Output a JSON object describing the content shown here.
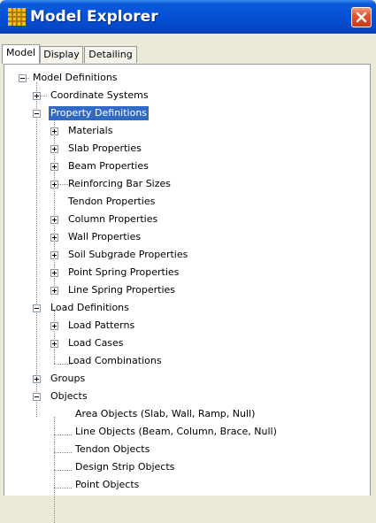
{
  "window": {
    "title": "Model Explorer",
    "app_icon": "grid-icon",
    "close_icon": "close-icon",
    "colors": {
      "titlebar": "#0550d6",
      "close": "#e0552f",
      "selection": "#316ac5"
    }
  },
  "tabs": [
    {
      "label": "Model",
      "active": true
    },
    {
      "label": "Display",
      "active": false
    },
    {
      "label": "Detailing",
      "active": false
    }
  ],
  "tree": {
    "root": "Model Definitions",
    "coordinate_systems": "Coordinate Systems",
    "property_definitions": "Property Definitions",
    "materials": "Materials",
    "slab_properties": "Slab Properties",
    "beam_properties": "Beam Properties",
    "reinforcing_bar_sizes": "Reinforcing Bar Sizes",
    "tendon_properties": "Tendon Properties",
    "column_properties": "Column Properties",
    "wall_properties": "Wall Properties",
    "soil_subgrade_properties": "Soil Subgrade Properties",
    "point_spring_properties": "Point Spring Properties",
    "line_spring_properties": "Line Spring Properties",
    "load_definitions": "Load Definitions",
    "load_patterns": "Load Patterns",
    "load_cases": "Load Cases",
    "load_combinations": "Load Combinations",
    "groups": "Groups",
    "objects": "Objects",
    "area_objects": "Area Objects (Slab, Wall, Ramp, Null)",
    "line_objects": "Line Objects (Beam, Column, Brace, Null)",
    "tendon_objects": "Tendon Objects",
    "design_strip_objects": "Design Strip Objects",
    "point_objects": "Point Objects",
    "selected": "Property Definitions"
  }
}
